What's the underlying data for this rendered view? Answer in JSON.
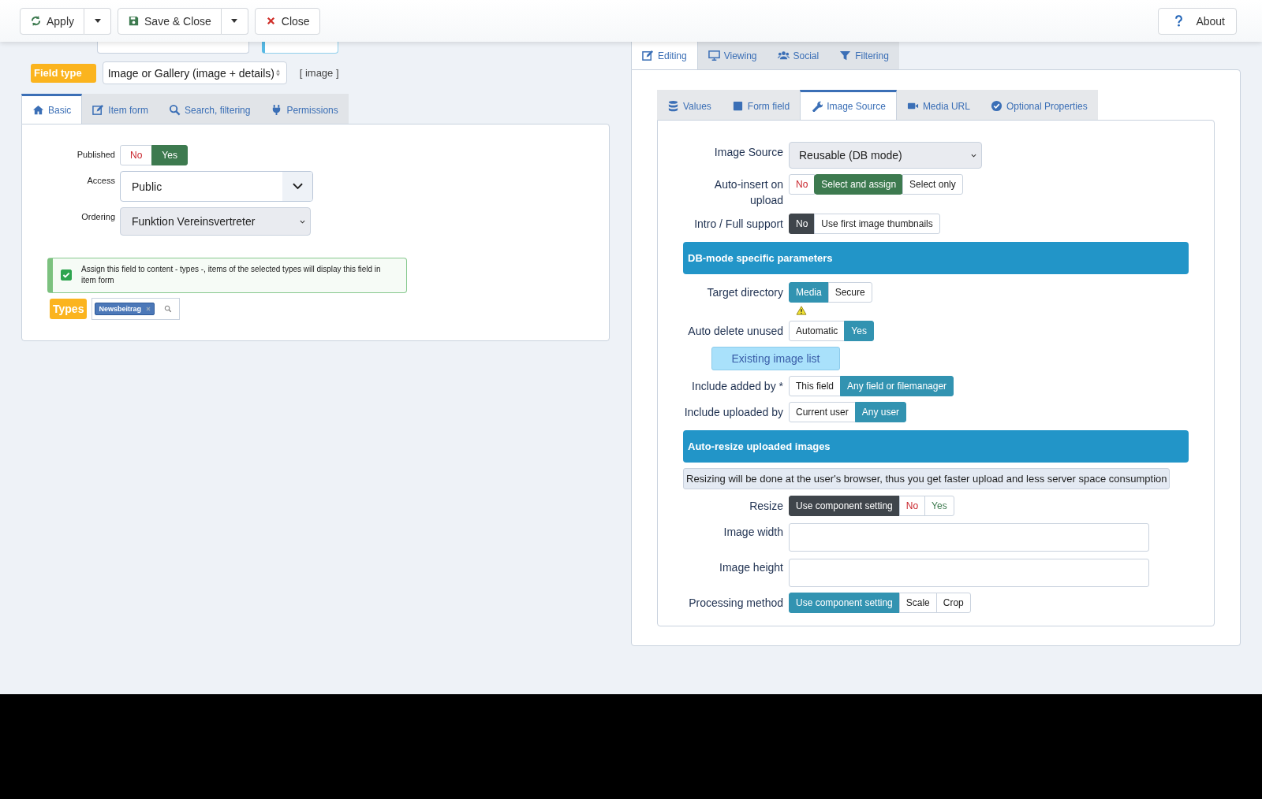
{
  "toolbar": {
    "buttons": [
      {
        "label": "Apply",
        "split": true
      },
      {
        "label": "Save & Close",
        "split": true
      },
      {
        "label": "Close",
        "split": false
      }
    ],
    "about": "About"
  },
  "field_type": {
    "label": "Field type",
    "value": "Image or Gallery (image + details)",
    "code": "[ image ]"
  },
  "left_tabs": [
    {
      "label": "Basic",
      "selected": true
    },
    {
      "label": "Item form",
      "selected": false
    },
    {
      "label": "Search, filtering",
      "selected": false
    },
    {
      "label": "Permissions",
      "selected": false
    }
  ],
  "basic": {
    "published": {
      "label": "Published",
      "color": "#3d7a4f",
      "options": [
        {
          "label": "No",
          "kind": "no",
          "selected": false
        },
        {
          "label": "Yes",
          "kind": "yes",
          "selected": true
        }
      ]
    },
    "access": {
      "label": "Access",
      "value": "Public"
    },
    "ordering": {
      "label": "Ordering",
      "value": "Funktion Vereinsvertreter"
    },
    "assign": {
      "text": "Assign this field to content - types -, items of the selected types will display this field in item form",
      "checked": true
    },
    "types": {
      "label": "Types",
      "tags": [
        "Newsbeitrag"
      ]
    }
  },
  "right_tabs": [
    {
      "label": "Editing",
      "selected": true
    },
    {
      "label": "Viewing",
      "selected": false
    },
    {
      "label": "Social",
      "selected": false
    },
    {
      "label": "Filtering",
      "selected": false
    }
  ],
  "inner_tabs": [
    {
      "label": "Values",
      "selected": false
    },
    {
      "label": "Form field",
      "selected": false
    },
    {
      "label": "Image Source",
      "selected": true
    },
    {
      "label": "Media URL",
      "selected": false
    },
    {
      "label": "Optional Properties",
      "selected": false
    }
  ],
  "rows": [
    {
      "kind": "select",
      "label": "Image Source",
      "value": "Reusable (DB mode)"
    },
    {
      "kind": "toggle",
      "label": "Auto-insert on upload",
      "color": "#3d7a4f",
      "options": [
        {
          "label": "No",
          "kind": "no",
          "selected": false
        },
        {
          "label": "Select and assign",
          "selected": true
        },
        {
          "label": "Select only",
          "selected": false
        }
      ]
    },
    {
      "kind": "toggle",
      "label": "Intro / Full support",
      "color": "#3f454b",
      "options": [
        {
          "label": "No",
          "selected": true
        },
        {
          "label": "Use first image thumbnails",
          "selected": false
        }
      ]
    },
    {
      "kind": "header",
      "label": "DB-mode specific parameters"
    },
    {
      "kind": "toggle",
      "label": "Target directory",
      "warning": true,
      "color": "#3293b1",
      "options": [
        {
          "label": "Media",
          "selected": true
        },
        {
          "label": "Secure",
          "selected": false
        }
      ]
    },
    {
      "kind": "toggle",
      "label": "Auto delete unused",
      "color": "#3293b1",
      "options": [
        {
          "label": "Automatic",
          "selected": false
        },
        {
          "label": "Yes",
          "selected": true
        }
      ]
    },
    {
      "kind": "button",
      "label": "Existing image list"
    },
    {
      "kind": "toggle",
      "label": "Include added by *",
      "color": "#3293b1",
      "options": [
        {
          "label": "This field",
          "selected": false
        },
        {
          "label": "Any field or filemanager",
          "selected": true
        }
      ]
    },
    {
      "kind": "toggle",
      "label": "Include uploaded by",
      "color": "#3293b1",
      "options": [
        {
          "label": "Current user",
          "selected": false
        },
        {
          "label": "Any user",
          "selected": true
        }
      ]
    },
    {
      "kind": "header",
      "label": "Auto-resize uploaded images"
    },
    {
      "kind": "note",
      "label": "Resizing will be done at the user's browser, thus you get faster upload and less server space consumption"
    },
    {
      "kind": "toggle",
      "label": "Resize",
      "color": "#3f454b",
      "options": [
        {
          "label": "Use component setting",
          "selected": true
        },
        {
          "label": "No",
          "kind": "no",
          "selected": false
        },
        {
          "label": "Yes",
          "kind": "yes",
          "selected": false
        }
      ]
    },
    {
      "kind": "input",
      "label": "Image width"
    },
    {
      "kind": "input",
      "label": "Image height"
    },
    {
      "kind": "toggle",
      "label": "Processing method",
      "color": "#3293b1",
      "options": [
        {
          "label": "Use component setting",
          "selected": true
        },
        {
          "label": "Scale",
          "selected": false
        },
        {
          "label": "Crop",
          "selected": false
        }
      ]
    }
  ]
}
